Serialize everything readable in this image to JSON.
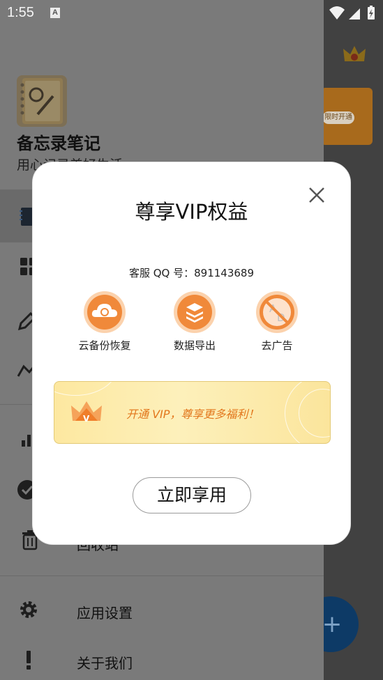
{
  "status_bar": {
    "time": "1:55",
    "notification_letter": "A"
  },
  "app_behind": {
    "banner_button": "限时开通"
  },
  "drawer": {
    "title": "备忘录笔记",
    "subtitle": "用心记录美好生活",
    "items": [
      {
        "label": "",
        "icon": "notebook-icon"
      },
      {
        "label": "",
        "icon": "grid-icon"
      },
      {
        "label": "",
        "icon": "pen-icon"
      },
      {
        "label": "",
        "icon": "chart-line-icon"
      },
      {
        "label": "",
        "icon": "bar-chart-icon"
      },
      {
        "label": "",
        "icon": "check-circle-icon"
      },
      {
        "label": "回收站",
        "icon": "trash-icon"
      },
      {
        "label": "应用设置",
        "icon": "gear-icon"
      },
      {
        "label": "关于我们",
        "icon": "exclamation-icon"
      }
    ]
  },
  "dialog": {
    "title": "尊享VIP权益",
    "qq_line": "客服 QQ 号：891143689",
    "features": [
      {
        "label": "云备份恢复",
        "icon": "cloud-sync-icon"
      },
      {
        "label": "数据导出",
        "icon": "layers-icon"
      },
      {
        "label": "去广告",
        "icon": "no-ads-icon"
      }
    ],
    "banner_text": "开通 VIP，尊享更多福利！",
    "use_button": "立即享用"
  },
  "colors": {
    "accent_orange": "#f0893a",
    "banner_text": "#e2761c",
    "fab": "#0d3a66"
  }
}
